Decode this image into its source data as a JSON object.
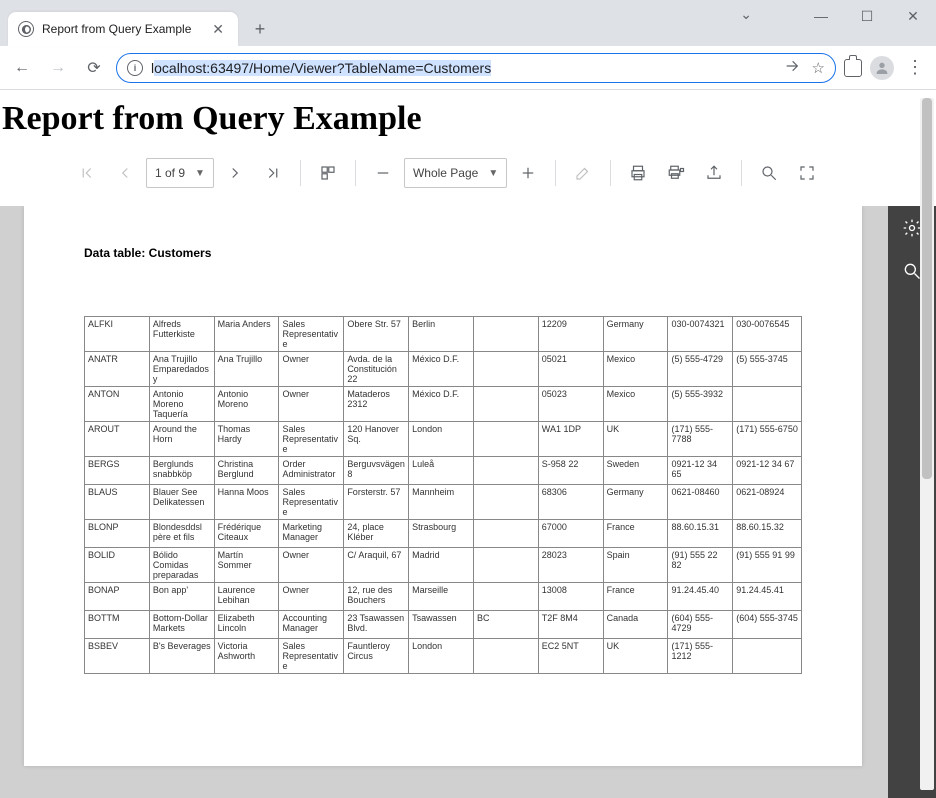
{
  "window": {
    "tab_title": "Report from Query Example",
    "url_prefix": "l",
    "url_selected": "ocalhost:63497/Home/Viewer?TableName=Customers"
  },
  "page": {
    "heading": "Report from Query Example"
  },
  "viewer": {
    "page_indicator": "1 of 9",
    "zoom_mode": "Whole Page"
  },
  "report": {
    "title": "Data table: Customers",
    "rows": [
      [
        "ALFKI",
        "Alfreds Futterkiste",
        "Maria Anders",
        "Sales Representative",
        "Obere Str. 57",
        "Berlin",
        "",
        "12209",
        "Germany",
        "030-0074321",
        "030-0076545"
      ],
      [
        "ANATR",
        "Ana Trujillo Emparedados y",
        "Ana Trujillo",
        "Owner",
        "Avda. de la Constitución 22",
        "México D.F.",
        "",
        "05021",
        "Mexico",
        "(5) 555-4729",
        "(5) 555-3745"
      ],
      [
        "ANTON",
        "Antonio Moreno Taquería",
        "Antonio Moreno",
        "Owner",
        "Mataderos 2312",
        "México D.F.",
        "",
        "05023",
        "Mexico",
        "(5) 555-3932",
        ""
      ],
      [
        "AROUT",
        "Around the Horn",
        "Thomas Hardy",
        "Sales Representative",
        "120 Hanover Sq.",
        "London",
        "",
        "WA1 1DP",
        "UK",
        "(171) 555-7788",
        "(171) 555-6750"
      ],
      [
        "BERGS",
        "Berglunds snabbköp",
        "Christina Berglund",
        "Order Administrator",
        "Berguvsvägen 8",
        "Luleå",
        "",
        "S-958 22",
        "Sweden",
        "0921-12 34 65",
        "0921-12 34 67"
      ],
      [
        "BLAUS",
        "Blauer See Delikatessen",
        "Hanna Moos",
        "Sales Representative",
        "Forsterstr. 57",
        "Mannheim",
        "",
        "68306",
        "Germany",
        "0621-08460",
        "0621-08924"
      ],
      [
        "BLONP",
        "Blondesddsl père et fils",
        "Frédérique Citeaux",
        "Marketing Manager",
        "24, place Kléber",
        "Strasbourg",
        "",
        "67000",
        "France",
        "88.60.15.31",
        "88.60.15.32"
      ],
      [
        "BOLID",
        "Bólido Comidas preparadas",
        "Martín Sommer",
        "Owner",
        "C/ Araquil, 67",
        "Madrid",
        "",
        "28023",
        "Spain",
        "(91) 555 22 82",
        "(91) 555 91 99"
      ],
      [
        "BONAP",
        "Bon app'",
        "Laurence Lebihan",
        "Owner",
        "12, rue des Bouchers",
        "Marseille",
        "",
        "13008",
        "France",
        "91.24.45.40",
        "91.24.45.41"
      ],
      [
        "BOTTM",
        "Bottom-Dollar Markets",
        "Elizabeth Lincoln",
        "Accounting Manager",
        "23 Tsawassen Blvd.",
        "Tsawassen",
        "BC",
        "T2F 8M4",
        "Canada",
        "(604) 555-4729",
        "(604) 555-3745"
      ],
      [
        "BSBEV",
        "B's Beverages",
        "Victoria Ashworth",
        "Sales Representative",
        "Fauntleroy Circus",
        "London",
        "",
        "EC2 5NT",
        "UK",
        "(171) 555-1212",
        ""
      ]
    ]
  }
}
